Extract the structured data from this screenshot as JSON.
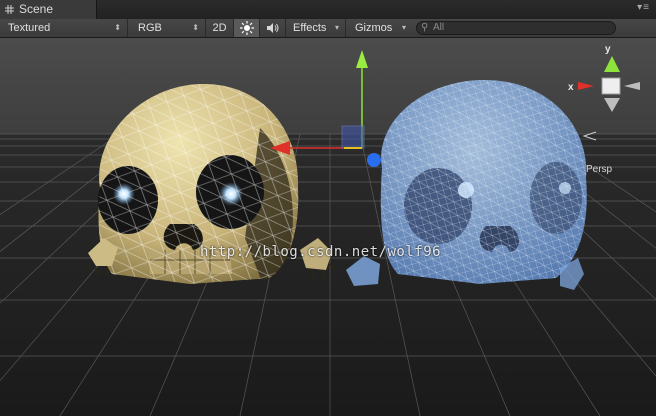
{
  "tab": {
    "title": "Scene"
  },
  "toolbar": {
    "shading_mode": "Textured",
    "render_mode": "RGB",
    "view_2d": "2D",
    "effects": "Effects",
    "gizmos": "Gizmos",
    "search_placeholder": "All"
  },
  "gizmo": {
    "y_label": "y",
    "x_label": "x",
    "projection": "Persp"
  },
  "watermark": "http://blog.csdn.net/wolf96",
  "icons": {
    "tab": "grid-icon",
    "lighting": "sun-icon",
    "audio": "speaker-icon",
    "search": "search-icon",
    "menu": "window-menu-icon"
  },
  "colors": {
    "selection": "#6a9ad8",
    "x_axis": "#e0302a",
    "y_axis": "#8ee23c",
    "z_axis": "#2a6ef0"
  }
}
